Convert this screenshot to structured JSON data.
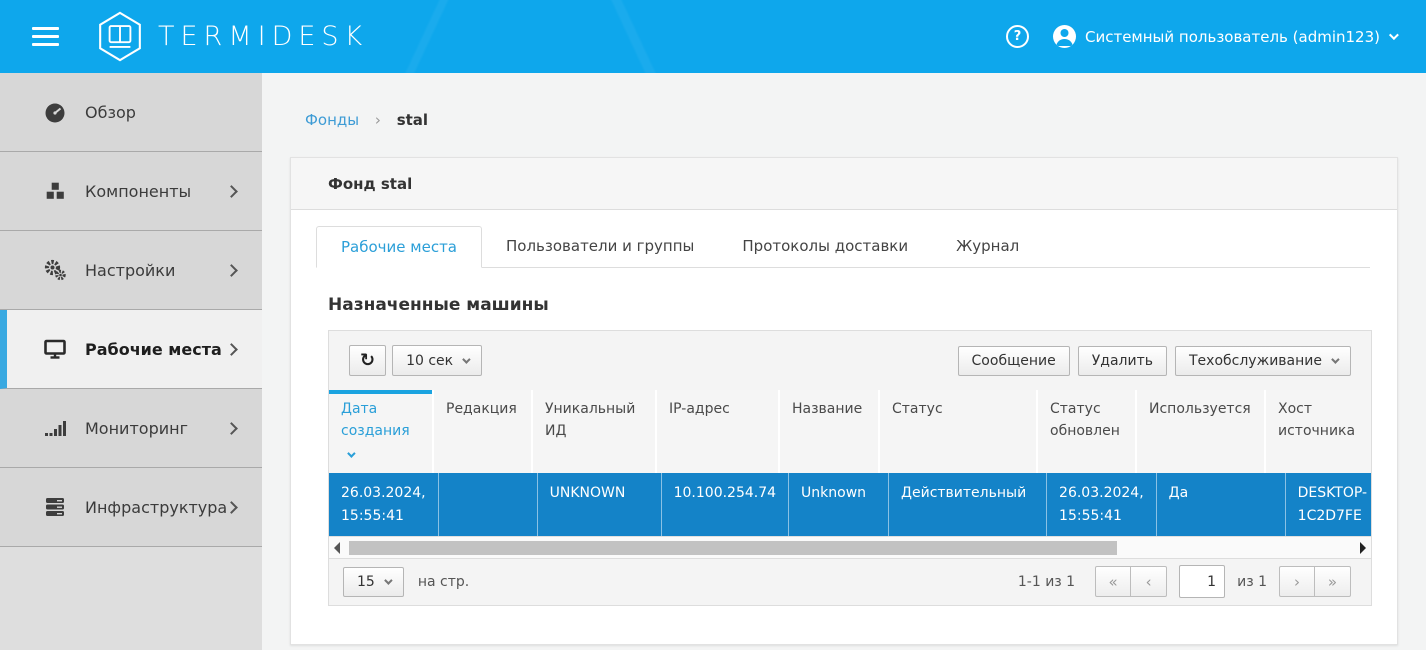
{
  "header": {
    "brand": "TERMIDESK",
    "help_label": "?",
    "user_name": "Системный пользователь (admin123)"
  },
  "sidebar": {
    "items": [
      {
        "label": "Обзор",
        "icon": "dashboard-icon",
        "has_submenu": false,
        "active": false
      },
      {
        "label": "Компоненты",
        "icon": "cubes-icon",
        "has_submenu": true,
        "active": false
      },
      {
        "label": "Настройки",
        "icon": "gears-icon",
        "has_submenu": true,
        "active": false
      },
      {
        "label": "Рабочие места",
        "icon": "monitor-icon",
        "has_submenu": true,
        "active": true
      },
      {
        "label": "Мониторинг",
        "icon": "bar-chart-icon",
        "has_submenu": true,
        "active": false
      },
      {
        "label": "Инфраструктура",
        "icon": "server-icon",
        "has_submenu": true,
        "active": false
      }
    ]
  },
  "breadcrumb": {
    "link": "Фонды",
    "separator": "›",
    "current": "stal"
  },
  "card": {
    "title": "Фонд stal"
  },
  "tabs": [
    {
      "label": "Рабочие места",
      "active": true
    },
    {
      "label": "Пользователи и группы",
      "active": false
    },
    {
      "label": "Протоколы доставки",
      "active": false
    },
    {
      "label": "Журнал",
      "active": false
    }
  ],
  "section": {
    "title": "Назначенные машины"
  },
  "toolbar": {
    "refresh_icon": "↻",
    "refresh_interval": "10 сек",
    "message_button": "Сообщение",
    "delete_button": "Удалить",
    "maintenance_button": "Техобслуживание"
  },
  "table": {
    "columns": [
      "Дата создания",
      "Редакция",
      "Уникальный ИД",
      "IP-адрес",
      "Название",
      "Статус",
      "Статус обновлен",
      "Используется",
      "Хост источника"
    ],
    "sorted_column": "Дата создания",
    "sort_direction": "desc",
    "rows": [
      [
        "26.03.2024, 15:55:41",
        "",
        "UNKNOWN",
        "10.100.254.74",
        "Unknown",
        "Действительный",
        "26.03.2024, 15:55:41",
        "Да",
        "DESKTOP-1C2D7FE"
      ]
    ]
  },
  "pagination": {
    "page_size": "15",
    "per_page_label": "на стр.",
    "range_label": "1-1 из 1",
    "first_button": "«",
    "prev_button": "‹",
    "page_input": "1",
    "of_label": "из 1",
    "next_button": "›",
    "last_button": "»"
  },
  "colors": {
    "header_blue": "#0ea7ec",
    "selected_row_blue": "#1483c8",
    "link_blue": "#3d9bd5",
    "sort_indicator_blue": "#1aa3e0",
    "sidebar_active_border": "#39a9e1"
  }
}
